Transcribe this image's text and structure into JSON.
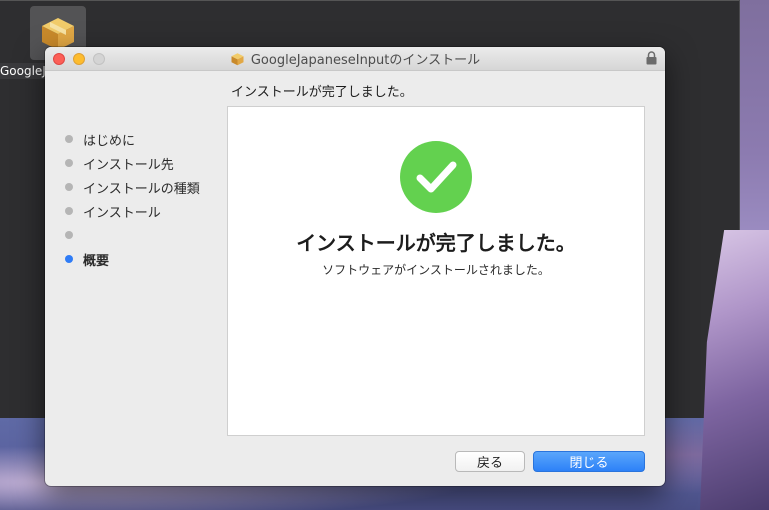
{
  "desktop": {
    "icon_label": "GoogleJap"
  },
  "window": {
    "title": "GoogleJapaneseInputのインストール",
    "header": "インストールが完了しました。"
  },
  "steps": [
    {
      "label": "はじめに",
      "active": false
    },
    {
      "label": "インストール先",
      "active": false
    },
    {
      "label": "インストールの種類",
      "active": false
    },
    {
      "label": "インストール",
      "active": false
    },
    {
      "label": "",
      "active": false
    },
    {
      "label": "概要",
      "active": true
    }
  ],
  "content": {
    "title": "インストールが完了しました。",
    "subtitle": "ソフトウェアがインストールされました。",
    "icon": "checkmark-icon",
    "success_color": "#63d14f"
  },
  "buttons": {
    "back_label": "戻る",
    "close_label": "閉じる"
  },
  "colors": {
    "accent": "#2f7cf6",
    "close": "#fc5f57",
    "minimize": "#fdbc2e"
  }
}
